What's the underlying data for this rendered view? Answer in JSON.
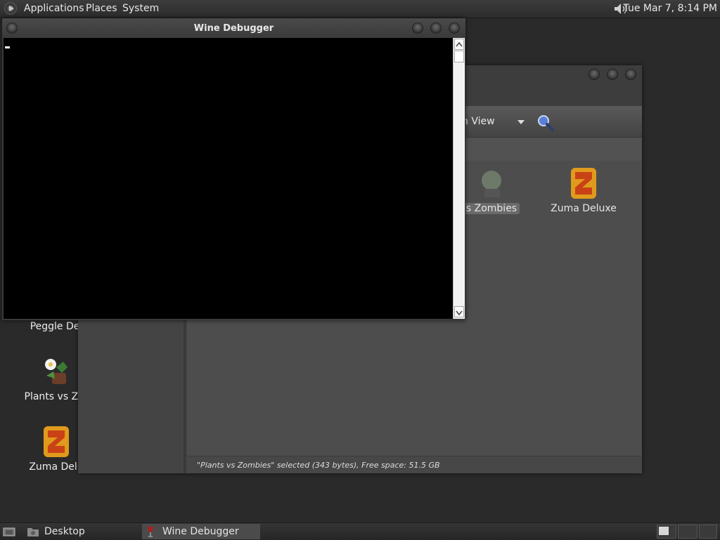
{
  "top_panel": {
    "menu_applications": "Applications",
    "menu_places": "Places",
    "menu_system": "System",
    "clock": "Tue Mar  7,  8:14 PM"
  },
  "desktop": {
    "icons": [
      {
        "label": "Peggle Del",
        "icon": "peggle-icon"
      },
      {
        "label": "Plants vs Zor",
        "icon": "plants-vs-zombies-icon"
      },
      {
        "label": "Zuma Delu",
        "icon": "zuma-deluxe-icon"
      }
    ]
  },
  "file_manager": {
    "view_label": "n View",
    "items": [
      {
        "label": "s Zombies",
        "selected": true
      },
      {
        "label": "Zuma Deluxe",
        "selected": false
      }
    ],
    "status": "\"Plants vs Zombies\" selected (343 bytes), Free space: 51.5 GB"
  },
  "debugger": {
    "title": "Wine Debugger"
  },
  "bottom_panel": {
    "desktop_label": "Desktop",
    "task_wine_debugger": "Wine Debugger"
  },
  "colors": {
    "panel": "#2f2f2f",
    "window": "#474747",
    "console": "#000000"
  }
}
